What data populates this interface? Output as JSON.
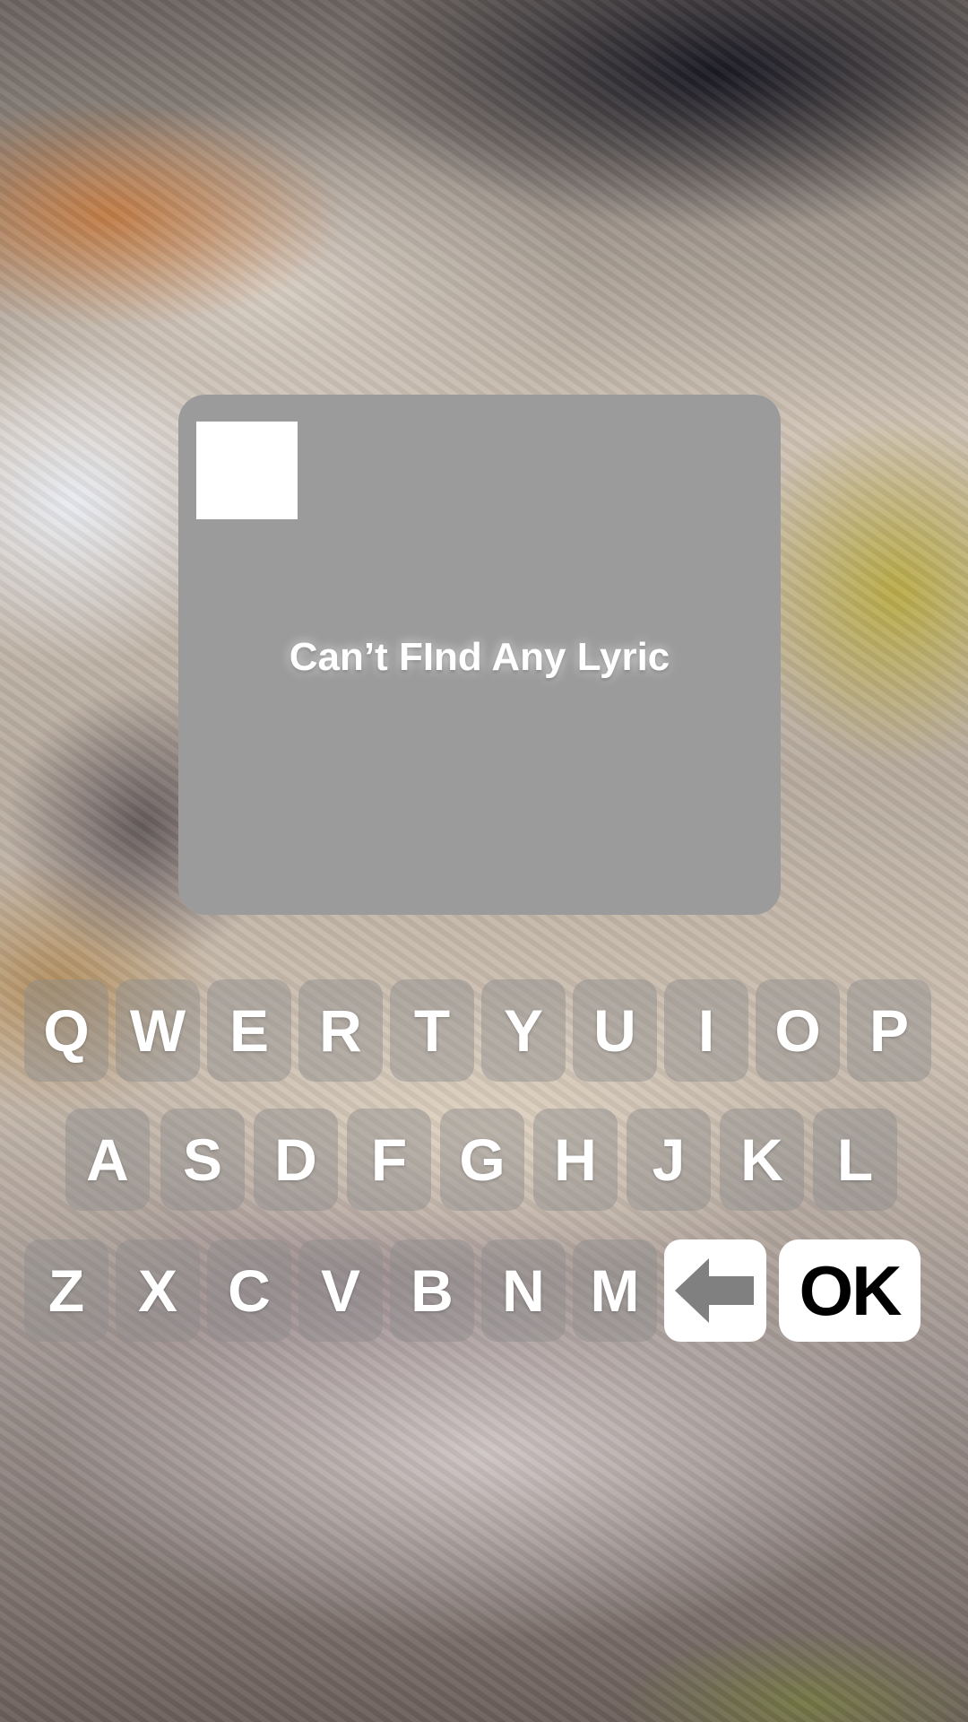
{
  "lyric_panel": {
    "message": "Can’t FInd Any Lyric",
    "thumbnail_icon": "blank-album-art"
  },
  "keyboard": {
    "row1": [
      "Q",
      "W",
      "E",
      "R",
      "T",
      "Y",
      "U",
      "I",
      "O",
      "P"
    ],
    "row2": [
      "A",
      "S",
      "D",
      "F",
      "G",
      "H",
      "J",
      "K",
      "L"
    ],
    "row3": [
      "Z",
      "X",
      "C",
      "V",
      "B",
      "N",
      "M"
    ],
    "backspace_icon": "backspace-arrow-icon",
    "ok_label": "OK",
    "accent_colors": {
      "key_bg": "#8c8c8c",
      "action_bg": "#ffffff",
      "backspace_arrow": "#808080"
    }
  }
}
